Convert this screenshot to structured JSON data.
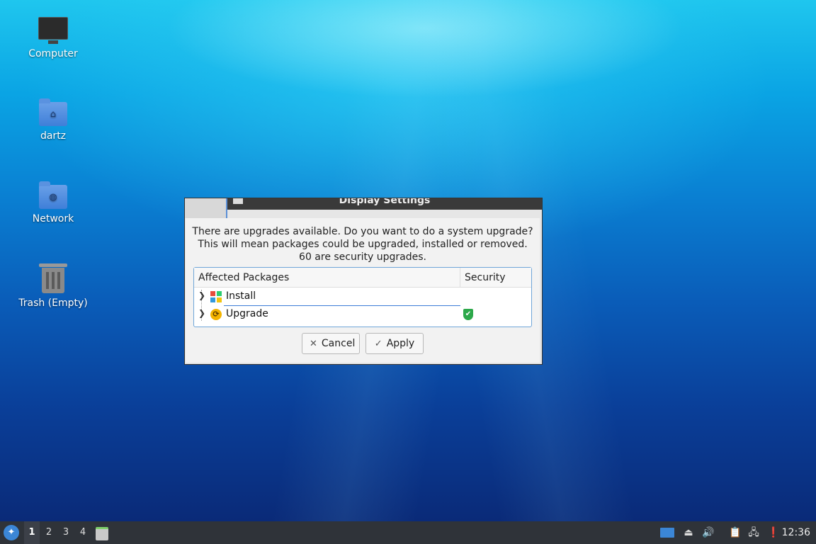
{
  "desktop": {
    "icons": [
      {
        "label": "Computer",
        "icon": "computer-icon"
      },
      {
        "label": "dartz",
        "icon": "home-folder-icon"
      },
      {
        "label": "Network",
        "icon": "network-folder-icon"
      },
      {
        "label": "Trash (Empty)",
        "icon": "trash-icon"
      }
    ]
  },
  "background_window": {
    "title": "Display Settings"
  },
  "dialog": {
    "message_line1": "There are upgrades available. Do you want to do a system upgrade?",
    "message_line2": "This will mean packages could be upgraded, installed or removed.",
    "message_line3": "60 are security upgrades.",
    "table": {
      "columns": [
        "Affected Packages",
        "Security"
      ],
      "rows": [
        {
          "label": "Install",
          "icon": "install-icon",
          "security": ""
        },
        {
          "label": "Upgrade",
          "icon": "upgrade-icon",
          "security": "shield-icon"
        }
      ]
    },
    "buttons": {
      "cancel": "Cancel",
      "apply": "Apply"
    }
  },
  "taskbar": {
    "workspaces": [
      "1",
      "2",
      "3",
      "4"
    ],
    "active_workspace": "1",
    "clock": "12:36"
  },
  "colors": {
    "accent": "#3b7bd6",
    "security_ok": "#2ca84a",
    "taskbar_bg": "#2f3339"
  }
}
